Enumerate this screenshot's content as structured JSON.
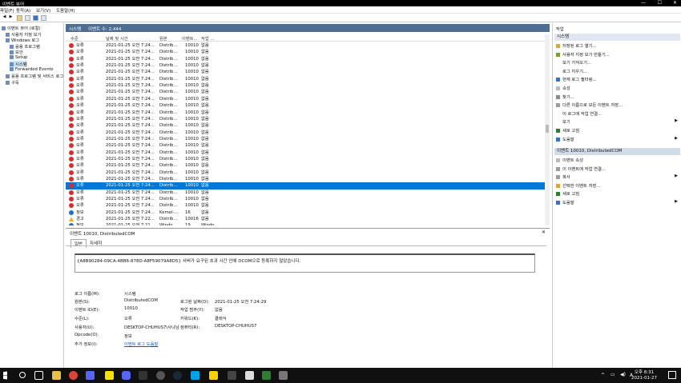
{
  "window": {
    "title": "이벤트 뷰어",
    "controls": [
      "—",
      "☐",
      "✕"
    ]
  },
  "menu": [
    "파일(F)",
    "동작(A)",
    "보기(V)",
    "도움말(H)"
  ],
  "tree": [
    {
      "label": "이벤트 뷰어 (로컬)",
      "level": 0
    },
    {
      "label": "사용자 지정 보기",
      "level": 1
    },
    {
      "label": "Windows 로그",
      "level": 1
    },
    {
      "label": "응용 프로그램",
      "level": 2
    },
    {
      "label": "보안",
      "level": 2
    },
    {
      "label": "Setup",
      "level": 2
    },
    {
      "label": "시스템",
      "level": 2,
      "selected": true
    },
    {
      "label": "Forwarded Events",
      "level": 2
    },
    {
      "label": "응용 프로그램 및 서비스 로그",
      "level": 1
    },
    {
      "label": "구독",
      "level": 1
    }
  ],
  "header": {
    "log_name": "시스템",
    "event_count": "이벤트 수: 2,444"
  },
  "columns": {
    "level": "수준",
    "datetime": "날짜 및 시간",
    "source": "원본",
    "event_id": "이벤트...",
    "category": "작업 ..."
  },
  "events": [
    {
      "sev": "err",
      "level": "오류",
      "datetime": "2021-01-25 오전 7:24...",
      "source": "Distrib...",
      "id": "10010",
      "cat": "없음"
    },
    {
      "sev": "err",
      "level": "오류",
      "datetime": "2021-01-25 오전 7:24...",
      "source": "Distrib...",
      "id": "10010",
      "cat": "없음"
    },
    {
      "sev": "err",
      "level": "오류",
      "datetime": "2021-01-25 오전 7:24...",
      "source": "Distrib...",
      "id": "10010",
      "cat": "없음"
    },
    {
      "sev": "err",
      "level": "오류",
      "datetime": "2021-01-25 오전 7:24...",
      "source": "Distrib...",
      "id": "10010",
      "cat": "없음"
    },
    {
      "sev": "err",
      "level": "오류",
      "datetime": "2021-01-25 오전 7:24...",
      "source": "Distrib...",
      "id": "10010",
      "cat": "없음"
    },
    {
      "sev": "err",
      "level": "오류",
      "datetime": "2021-01-25 오전 7:24...",
      "source": "Distrib...",
      "id": "10010",
      "cat": "없음"
    },
    {
      "sev": "err",
      "level": "오류",
      "datetime": "2021-01-25 오전 7:24...",
      "source": "Distrib...",
      "id": "10010",
      "cat": "없음"
    },
    {
      "sev": "err",
      "level": "오류",
      "datetime": "2021-01-25 오전 7:24...",
      "source": "Distrib...",
      "id": "10010",
      "cat": "없음"
    },
    {
      "sev": "err",
      "level": "오류",
      "datetime": "2021-01-25 오전 7:24...",
      "source": "Distrib...",
      "id": "10010",
      "cat": "없음"
    },
    {
      "sev": "err",
      "level": "오류",
      "datetime": "2021-01-25 오전 7:24...",
      "source": "Distrib...",
      "id": "10010",
      "cat": "없음"
    },
    {
      "sev": "err",
      "level": "오류",
      "datetime": "2021-01-25 오전 7:24...",
      "source": "Distrib...",
      "id": "10010",
      "cat": "없음"
    },
    {
      "sev": "err",
      "level": "오류",
      "datetime": "2021-01-25 오전 7:24...",
      "source": "Distrib...",
      "id": "10010",
      "cat": "없음"
    },
    {
      "sev": "err",
      "level": "오류",
      "datetime": "2021-01-25 오전 7:24...",
      "source": "Distrib...",
      "id": "10010",
      "cat": "없음"
    },
    {
      "sev": "err",
      "level": "오류",
      "datetime": "2021-01-25 오전 7:24...",
      "source": "Distrib...",
      "id": "10010",
      "cat": "없음"
    },
    {
      "sev": "err",
      "level": "오류",
      "datetime": "2021-01-25 오전 7:24...",
      "source": "Distrib...",
      "id": "10010",
      "cat": "없음"
    },
    {
      "sev": "err",
      "level": "오류",
      "datetime": "2021-01-25 오전 7:24...",
      "source": "Distrib...",
      "id": "10010",
      "cat": "없음"
    },
    {
      "sev": "err",
      "level": "오류",
      "datetime": "2021-01-25 오전 7:24...",
      "source": "Distrib...",
      "id": "10010",
      "cat": "없음"
    },
    {
      "sev": "err",
      "level": "오류",
      "datetime": "2021-01-25 오전 7:24...",
      "source": "Distrib...",
      "id": "10010",
      "cat": "없음"
    },
    {
      "sev": "err",
      "level": "오류",
      "datetime": "2021-01-25 오전 7:24...",
      "source": "Distrib...",
      "id": "10010",
      "cat": "없음"
    },
    {
      "sev": "err",
      "level": "오류",
      "datetime": "2021-01-25 오전 7:24...",
      "source": "Distrib...",
      "id": "10010",
      "cat": "없음"
    },
    {
      "sev": "err",
      "level": "오류",
      "datetime": "2021-01-25 오전 7:24...",
      "source": "Distrib...",
      "id": "10010",
      "cat": "없음"
    },
    {
      "sev": "err",
      "level": "오류",
      "datetime": "2021-01-25 오전 7:24...",
      "source": "Distrib...",
      "id": "10010",
      "cat": "없음",
      "selected": true
    },
    {
      "sev": "err",
      "level": "오류",
      "datetime": "2021-01-25 오전 7:24...",
      "source": "Distrib...",
      "id": "10010",
      "cat": "없음"
    },
    {
      "sev": "err",
      "level": "오류",
      "datetime": "2021-01-25 오전 7:24...",
      "source": "Distrib...",
      "id": "10010",
      "cat": "없음"
    },
    {
      "sev": "err",
      "level": "오류",
      "datetime": "2021-01-25 오전 7:24...",
      "source": "Distrib...",
      "id": "10010",
      "cat": "없음"
    },
    {
      "sev": "info",
      "level": "정보",
      "datetime": "2021-01-25 오전 7:24...",
      "source": "Kernel-...",
      "id": "16",
      "cat": "없음"
    },
    {
      "sev": "warn",
      "level": "경고",
      "datetime": "2021-01-25 오전 7:22...",
      "source": "Distrib...",
      "id": "10016",
      "cat": "없음"
    },
    {
      "sev": "info",
      "level": "정보",
      "datetime": "2021-01-25 오전 7:21...",
      "source": "Windo...",
      "id": "19",
      "cat": "Windo..."
    }
  ],
  "detail": {
    "title": "이벤트 10010, DistributedCOM",
    "tabs": [
      "일반",
      "자세히"
    ],
    "message": "{A8B90284-09CA-4BB6-878D-A8F59079A8D5} 서버가 요구된 초과 시간 안에 DCOM으로 등록하지 않았습니다.",
    "fields": {
      "log_name_label": "로그 이름(M):",
      "log_name": "시스템",
      "source_label": "원본(S):",
      "source": "DistributedCOM",
      "logged_label": "로그된 날짜(D):",
      "logged": "2021-01-25 오전 7:24:29",
      "event_id_label": "이벤트 ID(E):",
      "event_id": "10010",
      "task_label": "작업 범주(Y):",
      "task": "없음",
      "level_label": "수준(L):",
      "level": "오류",
      "keywords_label": "키워드(K):",
      "keywords": "클래식",
      "user_label": "사용자(U):",
      "user": "DESKTOP-CHUHUS7\\사냐남",
      "computer_label": "컴퓨터(R):",
      "computer": "DESKTOP-CHUHUS7",
      "opcode_label": "Opcode(O):",
      "opcode": "정보",
      "more_label": "추가 정보(I):",
      "more_link": "이벤트 로그 도움말"
    }
  },
  "actions": {
    "title": "작업",
    "section1": "시스템",
    "items1": [
      "저장된 로그 열기...",
      "사용자 지정 보기 만들기...",
      "보기 가져오기...",
      "로그 지우기...",
      "현재 로그 필터링...",
      "속성",
      "찾기...",
      "다른 이름으로 모든 이벤트 저장...",
      "이 로그에 작업 연결...",
      "보기",
      "새로 고침",
      "도움말"
    ],
    "section2": "이벤트 10010, DistributedCOM",
    "items2": [
      "이벤트 속성",
      "이 이벤트에 작업 연결...",
      "복사",
      "선택한 이벤트 저장...",
      "새로 고침",
      "도움말"
    ]
  },
  "taskbar": {
    "time": "오후 8:31",
    "date": "2021-01-27"
  }
}
